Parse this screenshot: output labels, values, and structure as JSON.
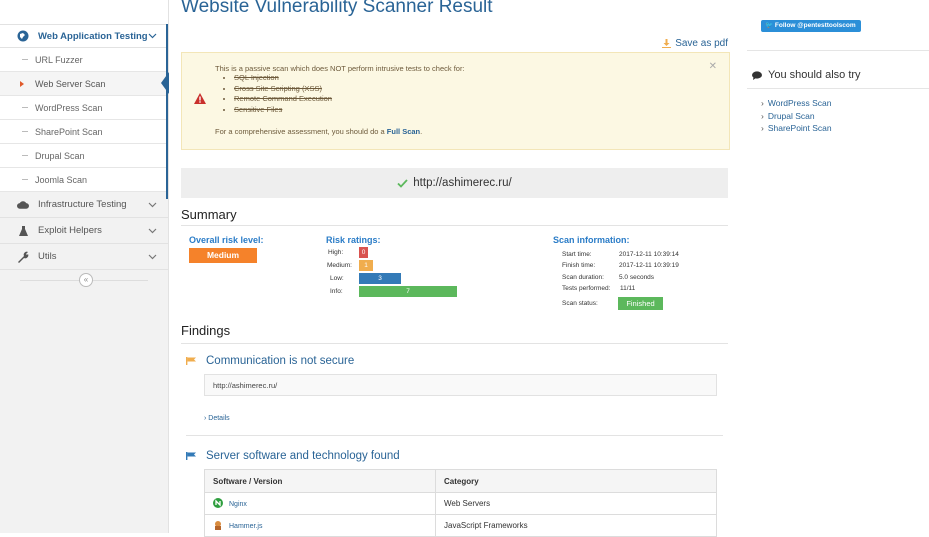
{
  "sidebar": {
    "sections": [
      {
        "label": "Web Application Testing",
        "icon": "globe-icon"
      },
      {
        "label": "Infrastructure Testing",
        "icon": "cloud-icon"
      },
      {
        "label": "Exploit Helpers",
        "icon": "flask-icon"
      },
      {
        "label": "Utils",
        "icon": "wrench-icon"
      }
    ],
    "web_items": [
      {
        "label": "URL Fuzzer"
      },
      {
        "label": "Web Server Scan"
      },
      {
        "label": "WordPress Scan"
      },
      {
        "label": "SharePoint Scan"
      },
      {
        "label": "Drupal Scan"
      },
      {
        "label": "Joomla Scan"
      }
    ],
    "active_item": "Web Server Scan",
    "collapse_icon": "«"
  },
  "main": {
    "title": "Website Vulnerability Scanner Result",
    "save_pdf": "Save as pdf",
    "warning": {
      "intro": "This is a passive scan which does NOT perform intrusive tests to check for:",
      "items": [
        "SQL Injection",
        "Cross Site Scripting (XSS)",
        "Remote Command Execution",
        "Sensitive Files"
      ],
      "footer_prefix": "For a comprehensive assessment, you should do a",
      "footer_link": "Full Scan",
      "footer_suffix": "."
    },
    "target_url": "http://ashimerec.ru/",
    "summary": {
      "heading": "Summary",
      "overall_label": "Overall risk level:",
      "overall_value": "Medium",
      "ratings_label": "Risk ratings:",
      "ratings": [
        {
          "label": "High:",
          "value": "0",
          "count": 0,
          "color": "#d9534f"
        },
        {
          "label": "Medium:",
          "value": "1",
          "count": 1,
          "color": "#f0ad4e"
        },
        {
          "label": "Low:",
          "value": "3",
          "count": 3,
          "color": "#337ab7"
        },
        {
          "label": "Info:",
          "value": "7",
          "count": 7,
          "color": "#5cb85c"
        }
      ],
      "scan_info_label": "Scan information:",
      "scan_info": [
        {
          "label": "Start time:",
          "value": "2017-12-11 10:39:14"
        },
        {
          "label": "Finish time:",
          "value": "2017-12-11 10:39:19"
        },
        {
          "label": "Scan duration:",
          "value": "5.0 seconds"
        },
        {
          "label": "Tests performed:",
          "value": "11/11"
        }
      ],
      "scan_status_label": "Scan status:",
      "scan_status": "Finished"
    },
    "findings": {
      "heading": "Findings",
      "items": [
        {
          "title": "Communication is not secure",
          "flag_color": "#f0ad4e",
          "url": "http://ashimerec.ru/",
          "details": "Details"
        },
        {
          "title": "Server software and technology found",
          "flag_color": "#337ab7"
        }
      ],
      "table": {
        "headers": [
          "Software / Version",
          "Category"
        ],
        "rows": [
          {
            "software": "Nginx",
            "category": "Web Servers"
          },
          {
            "software": "Hammer.js",
            "category": "JavaScript Frameworks"
          }
        ]
      }
    }
  },
  "right": {
    "twitter": "Follow @pentesttoolscom",
    "try_title": "You should also try",
    "try_items": [
      "WordPress Scan",
      "Drupal Scan",
      "SharePoint Scan"
    ]
  },
  "colors": {
    "primary": "#2a6496",
    "medium_badge": "#f5822a",
    "finished": "#5cb85c",
    "warning_bg": "#fcf8e3"
  }
}
